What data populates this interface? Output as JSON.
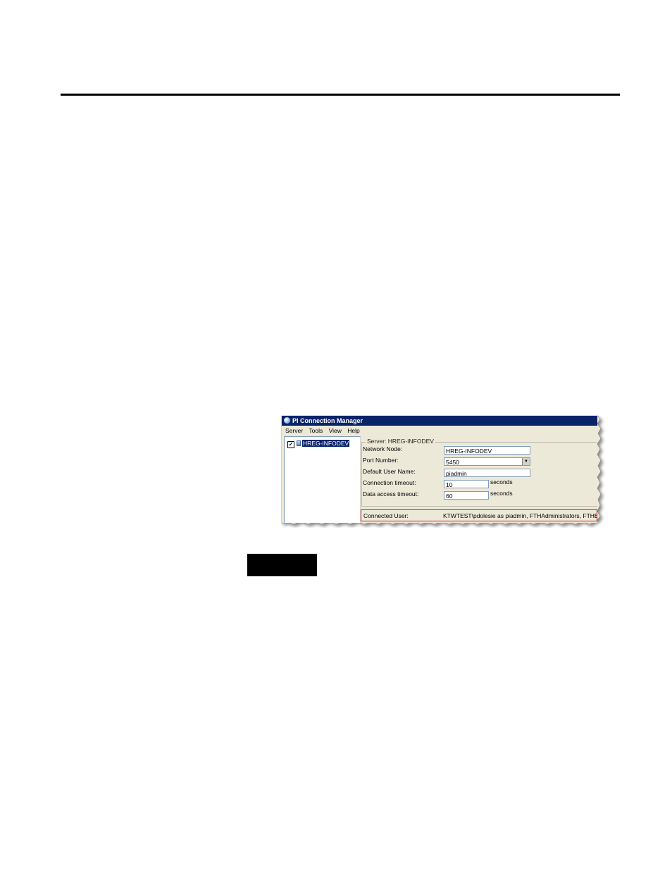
{
  "window": {
    "title": "PI Connection Manager"
  },
  "menu": [
    "Server",
    "Tools",
    "View",
    "Help"
  ],
  "tree": {
    "server_item": "HREG-INFODEV",
    "checked": true
  },
  "details": {
    "group_title": "Server: HREG-INFODEV",
    "network_node_label": "Network Node:",
    "network_node_value": "HREG-INFODEV",
    "port_label": "Port Number:",
    "port_value": "5450",
    "default_user_label": "Default User Name:",
    "default_user_value": "piadmin",
    "conn_timeout_label": "Connection timeout:",
    "conn_timeout_value": "10",
    "conn_timeout_unit": "seconds",
    "data_timeout_label": "Data access timeout:",
    "data_timeout_value": "60",
    "data_timeout_unit": "seconds"
  },
  "status": {
    "connected_user_label": "Connected User:",
    "connected_user_value": "KTWTEST\\pdolesie as piadmin, FTHAdministrators, FTHEngineers"
  },
  "colors": {
    "titlebar": "#0a246a",
    "highlight_box": "#d6232a",
    "window_bg": "#ece9d8"
  }
}
